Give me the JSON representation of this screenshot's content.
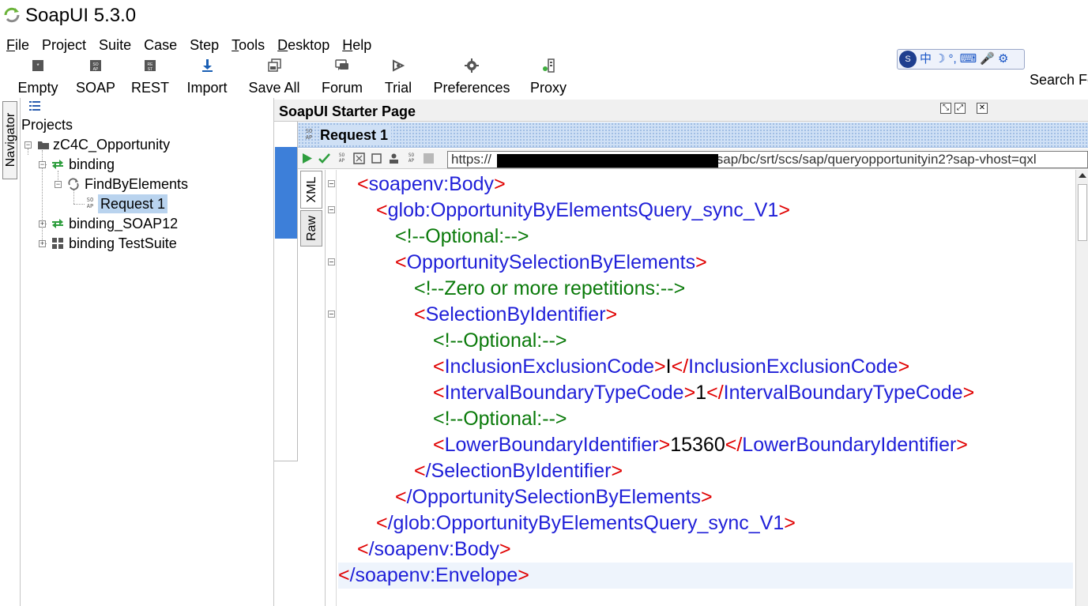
{
  "window": {
    "title": "SoapUI 5.3.0"
  },
  "menu": {
    "items": [
      {
        "mnemonic": "F",
        "rest": "ile"
      },
      {
        "mnemonic": "",
        "rest": "Project"
      },
      {
        "mnemonic": "",
        "rest": "Suite"
      },
      {
        "mnemonic": "",
        "rest": "Case"
      },
      {
        "mnemonic": "",
        "rest": "Step"
      },
      {
        "mnemonic": "T",
        "rest": "ools"
      },
      {
        "mnemonic": "D",
        "rest": "esktop"
      },
      {
        "mnemonic": "H",
        "rest": "elp"
      }
    ]
  },
  "toolbar": {
    "empty": "Empty",
    "soap": "SOAP",
    "rest": "REST",
    "import": "Import",
    "save_all": "Save All",
    "forum": "Forum",
    "trial": "Trial",
    "preferences": "Preferences",
    "proxy": "Proxy",
    "search": "Search Fo"
  },
  "ime": {
    "chars": [
      "中",
      "☽",
      "°,",
      "⌨",
      "🎤",
      "⚙"
    ]
  },
  "navigator": {
    "tab_label": "Navigator",
    "root": "Projects",
    "project": "zC4C_Opportunity",
    "binding": "binding",
    "operation": "FindByElements",
    "request": "Request 1",
    "binding_soap12": "binding_SOAP12",
    "test_suite": "binding TestSuite"
  },
  "tabs": {
    "starter_page": "SoapUI Starter Page"
  },
  "request": {
    "title": "Request 1",
    "endpoint_prefix": "https://",
    "endpoint_suffix": "/sap/bc/srt/scs/sap/queryopportunityin2?sap-vhost=qxl",
    "tab_xml": "XML",
    "tab_raw": "Raw"
  },
  "xml_lines": {
    "l1_tag": "soapenv:Body",
    "l2_tag": "glob:OpportunityByElementsQuery_sync_V1",
    "l3_comment": "<!--Optional:-->",
    "l4_tag": "OpportunitySelectionByElements",
    "l5_comment": "<!--Zero or more repetitions:-->",
    "l6_tag": "SelectionByIdentifier",
    "l7_comment": "<!--Optional:-->",
    "l8_tag": "InclusionExclusionCode",
    "l8_value": "I",
    "l9_tag": "IntervalBoundaryTypeCode",
    "l9_value": "1",
    "l10_comment": "<!--Optional:-->",
    "l11_tag": "LowerBoundaryIdentifier",
    "l11_value": "15360",
    "l12_tag": "/SelectionByIdentifier",
    "l13_tag": "/OpportunitySelectionByElements",
    "l14_tag": "/glob:OpportunityByElementsQuery_sync_V1",
    "l15_tag": "/soapenv:Body",
    "l16_tag": "/soapenv:Envelope"
  },
  "colors": {
    "bracket": "#e00000",
    "element": "#1f1fd8",
    "comment": "#0a7a0a",
    "selection": "#b9d3ee",
    "accent": "#3d7fd9"
  }
}
